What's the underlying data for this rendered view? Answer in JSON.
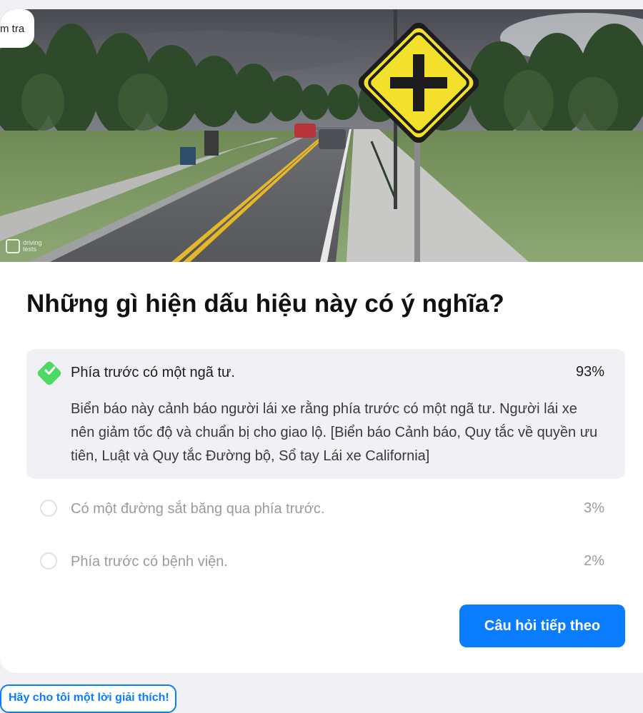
{
  "badge": {
    "label": "m tra"
  },
  "hero": {
    "watermark_line1": "driving",
    "watermark_line2": "tests",
    "sign_color": "#f2e02a",
    "sign_symbol": "cross-intersection"
  },
  "question": {
    "title": "Những gì hiện dấu hiệu này có ý nghĩa?"
  },
  "answers": [
    {
      "text": "Phía trước có một ngã tư.",
      "percent": "93%",
      "correct": true,
      "explanation": "Biển báo này cảnh báo người lái xe rằng phía trước có một ngã tư. Người lái xe nên giảm tốc độ và chuẩn bị cho giao lộ. [Biển báo Cảnh báo, Quy tắc về quyền ưu tiên, Luật và Quy tắc Đường bộ, Sổ tay Lái xe California]"
    },
    {
      "text": "Có một đường sắt băng qua phía trước.",
      "percent": "3%",
      "correct": false
    },
    {
      "text": "Phía trước có bệnh viện.",
      "percent": "2%",
      "correct": false
    }
  ],
  "buttons": {
    "next": "Câu hỏi tiếp theo",
    "explain": "Hãy cho tôi một lời giải thích!"
  },
  "colors": {
    "accent": "#0a7cff",
    "correct": "#4cd964",
    "page_bg": "#efeff4"
  }
}
